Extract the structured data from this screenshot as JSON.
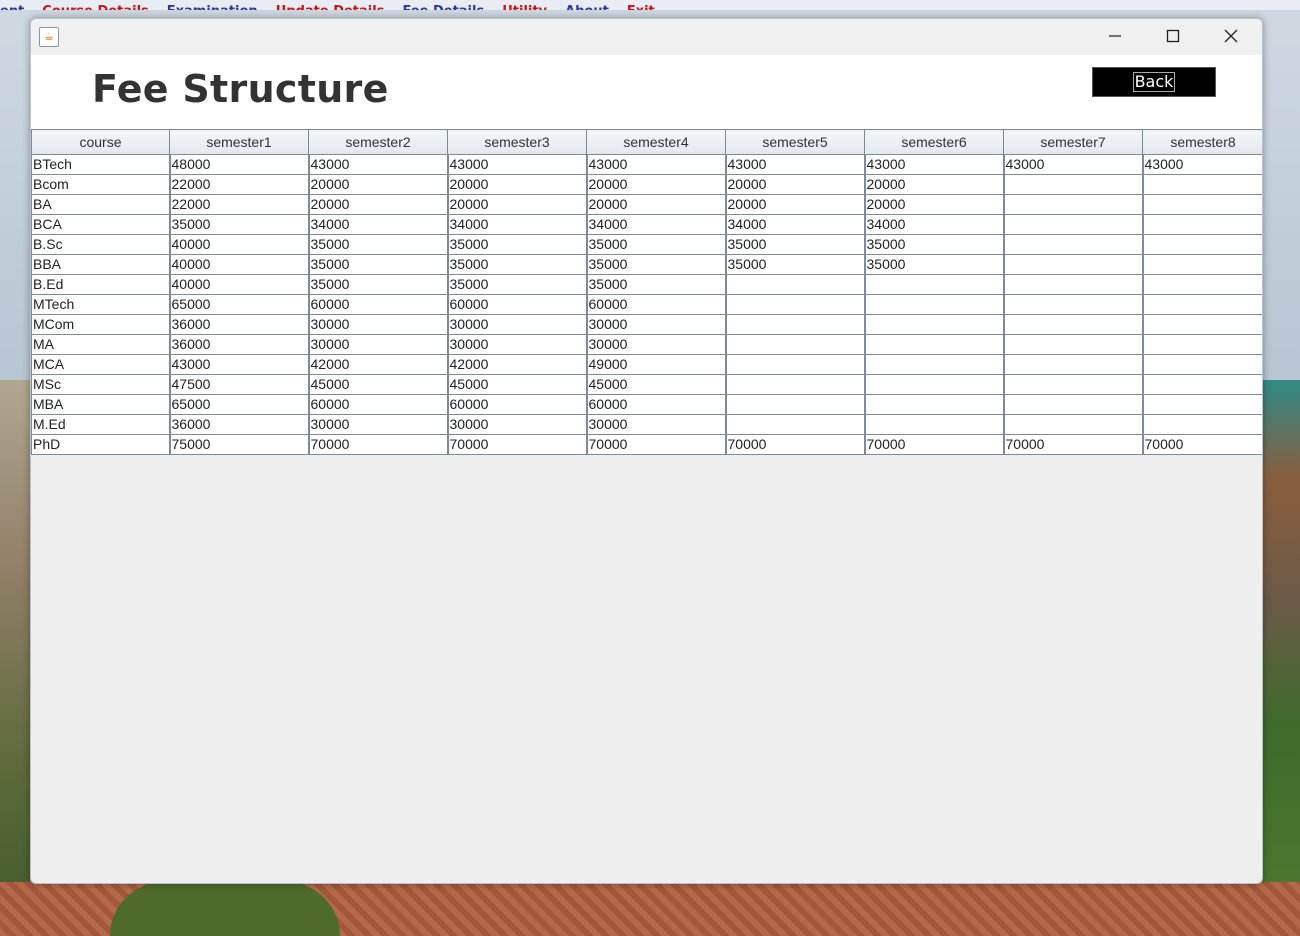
{
  "parent_menu": [
    {
      "label": "ent",
      "color": "#2a3aa0"
    },
    {
      "label": "Course Details",
      "color": "#c01818"
    },
    {
      "label": "Examination",
      "color": "#2a3aa0"
    },
    {
      "label": "Update Details",
      "color": "#c01818"
    },
    {
      "label": "Fee Details",
      "color": "#2a3aa0"
    },
    {
      "label": "Utility",
      "color": "#c01818"
    },
    {
      "label": "About",
      "color": "#2a3aa0"
    },
    {
      "label": "Exit",
      "color": "#c01818"
    }
  ],
  "window": {
    "icon": "java-cup-icon",
    "controls": [
      "minimize-icon",
      "maximize-icon",
      "close-icon"
    ]
  },
  "header": {
    "title": "Fee Structure",
    "back_label": "Back"
  },
  "table": {
    "columns": [
      "course",
      "semester1",
      "semester2",
      "semester3",
      "semester4",
      "semester5",
      "semester6",
      "semester7",
      "semester8"
    ],
    "rows": [
      [
        "BTech",
        "48000",
        "43000",
        "43000",
        "43000",
        "43000",
        "43000",
        "43000",
        "43000"
      ],
      [
        "Bcom",
        "22000",
        "20000",
        "20000",
        "20000",
        "20000",
        "20000",
        "",
        ""
      ],
      [
        "BA",
        "22000",
        "20000",
        "20000",
        "20000",
        "20000",
        "20000",
        "",
        ""
      ],
      [
        "BCA",
        "35000",
        "34000",
        "34000",
        "34000",
        "34000",
        "34000",
        "",
        ""
      ],
      [
        "B.Sc",
        "40000",
        "35000",
        "35000",
        "35000",
        "35000",
        "35000",
        "",
        ""
      ],
      [
        "BBA",
        "40000",
        "35000",
        "35000",
        "35000",
        "35000",
        "35000",
        "",
        ""
      ],
      [
        "B.Ed",
        "40000",
        "35000",
        "35000",
        "35000",
        "",
        "",
        "",
        ""
      ],
      [
        "MTech",
        "65000",
        "60000",
        "60000",
        "60000",
        "",
        "",
        "",
        ""
      ],
      [
        "MCom",
        "36000",
        "30000",
        "30000",
        "30000",
        "",
        "",
        "",
        ""
      ],
      [
        "MA",
        "36000",
        "30000",
        "30000",
        "30000",
        "",
        "",
        "",
        ""
      ],
      [
        "MCA",
        "43000",
        "42000",
        "42000",
        "49000",
        "",
        "",
        "",
        ""
      ],
      [
        "MSc",
        "47500",
        "45000",
        "45000",
        "45000",
        "",
        "",
        "",
        ""
      ],
      [
        "MBA",
        "65000",
        "60000",
        "60000",
        "60000",
        "",
        "",
        "",
        ""
      ],
      [
        "M.Ed",
        "36000",
        "30000",
        "30000",
        "30000",
        "",
        "",
        "",
        ""
      ],
      [
        "PhD",
        "75000",
        "70000",
        "70000",
        "70000",
        "70000",
        "70000",
        "70000",
        "70000"
      ]
    ]
  }
}
